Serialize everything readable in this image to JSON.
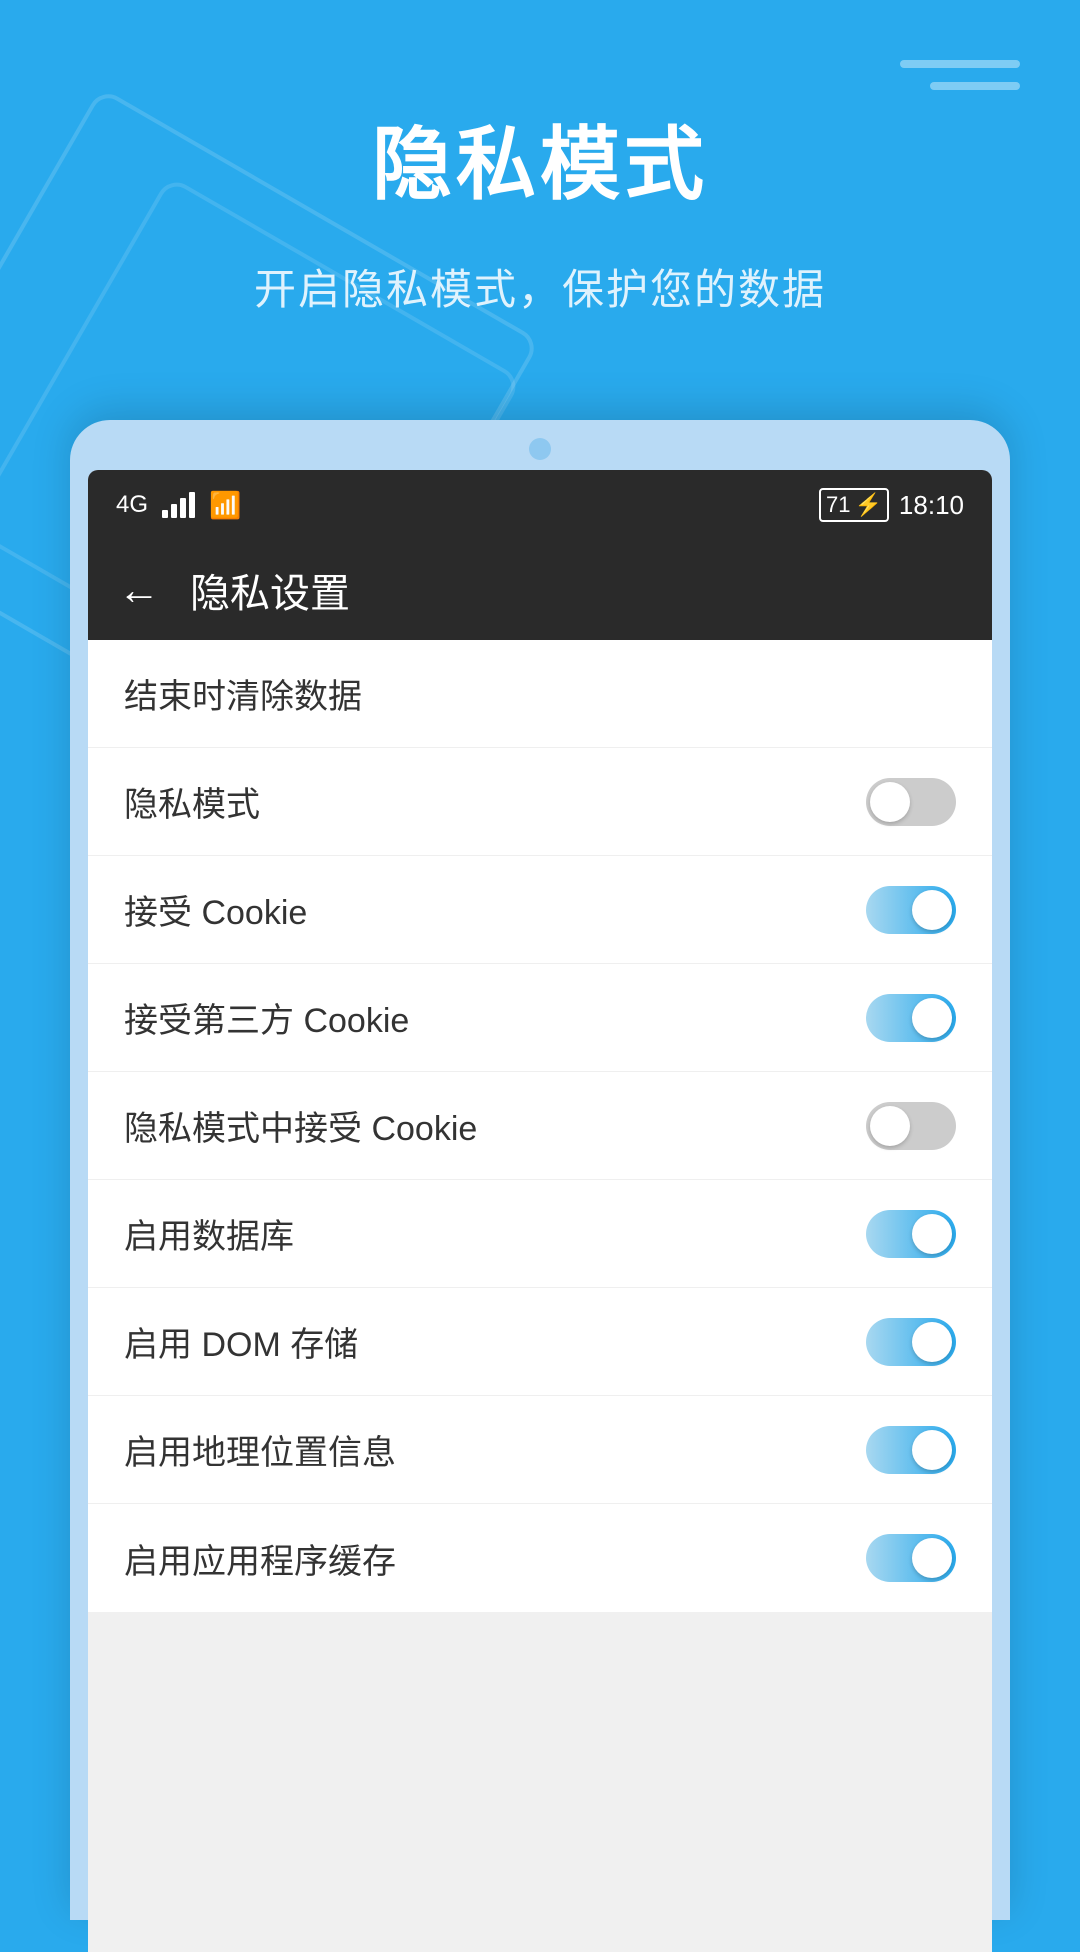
{
  "page": {
    "bg_color": "#29aaed",
    "title": "隐私模式",
    "subtitle": "开启隐私模式，保护您的数据"
  },
  "status_bar": {
    "signal": "4G",
    "battery": "71",
    "time": "18:10"
  },
  "app_header": {
    "back_label": "←",
    "title": "隐私设置"
  },
  "settings": [
    {
      "id": "clear-data",
      "label": "结束时清除数据",
      "has_toggle": false,
      "toggle_on": false
    },
    {
      "id": "privacy-mode",
      "label": "隐私模式",
      "has_toggle": true,
      "toggle_on": false
    },
    {
      "id": "accept-cookie",
      "label": "接受 Cookie",
      "has_toggle": true,
      "toggle_on": true
    },
    {
      "id": "accept-third-cookie",
      "label": "接受第三方 Cookie",
      "has_toggle": true,
      "toggle_on": true
    },
    {
      "id": "private-cookie",
      "label": "隐私模式中接受 Cookie",
      "has_toggle": true,
      "toggle_on": false
    },
    {
      "id": "enable-db",
      "label": "启用数据库",
      "has_toggle": true,
      "toggle_on": true
    },
    {
      "id": "enable-dom",
      "label": "启用 DOM 存储",
      "has_toggle": true,
      "toggle_on": true
    },
    {
      "id": "enable-geo",
      "label": "启用地理位置信息",
      "has_toggle": true,
      "toggle_on": true
    },
    {
      "id": "enable-appcache",
      "label": "启用应用程序缓存",
      "has_toggle": true,
      "toggle_on": true
    }
  ]
}
